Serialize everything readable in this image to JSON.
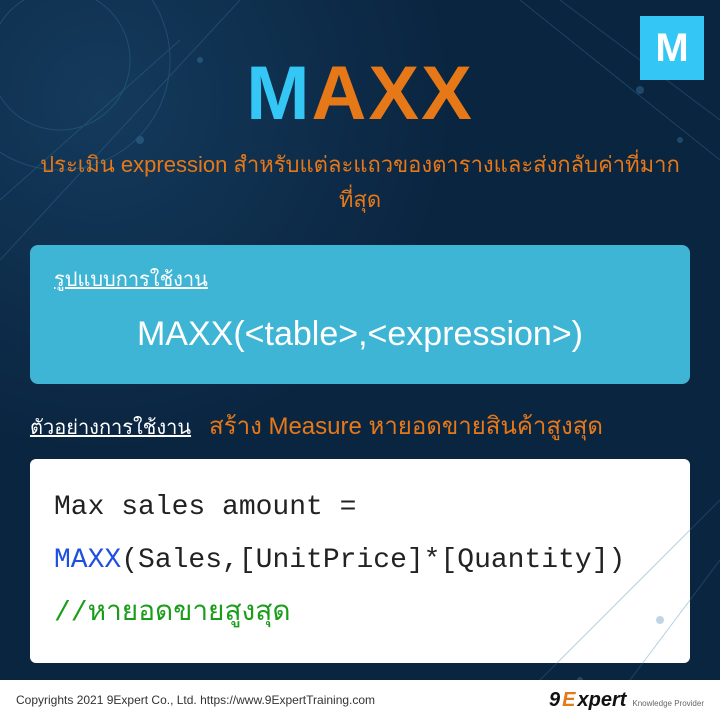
{
  "badge": "M",
  "title": {
    "part1": "M",
    "part2": "AXX"
  },
  "subtitle": "ประเมิน expression สำหรับแต่ละแถวของตารางและส่งกลับค่าที่มากที่สุด",
  "usage": {
    "label": "รูปแบบการใช้งาน",
    "syntax": "MAXX(<table>,<expression>)"
  },
  "example": {
    "label": "ตัวอย่างการใช้งาน",
    "desc": "สร้าง Measure หายอดขายสินค้าสูงสุด"
  },
  "code": {
    "line1": "Max sales amount =",
    "fn": "MAXX",
    "args": "(Sales,[UnitPrice]*[Quantity])",
    "comment": "//หายอดขายสูงสุด"
  },
  "footer": {
    "copyright": "Copyrights 2021 9Expert Co., Ltd.   https://www.9ExpertTraining.com",
    "brand_nine": "9",
    "brand_e": "E",
    "brand_xpert": "xpert",
    "brand_tag": "Knowledge Provider"
  }
}
